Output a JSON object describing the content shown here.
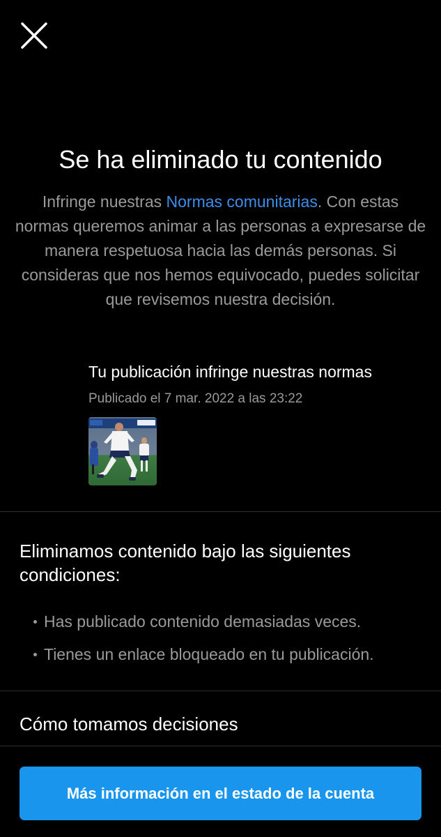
{
  "header": {
    "close_icon": "close-icon"
  },
  "notice": {
    "title": "Se ha eliminado tu contenido",
    "desc_before": "Infringe nuestras ",
    "desc_link": "Normas comunitarias",
    "desc_after": ". Con estas normas queremos animar a las personas a expresarse de manera respetuosa hacia las demás personas. Si consideras que nos hemos equivocado, puedes solicitar que revisemos nuestra decisión.",
    "link_color": "#3b8eea"
  },
  "post": {
    "title": "Tu publicación infringe nuestras normas",
    "date": "Publicado el 7 mar. 2022 a las 23:22",
    "thumbnail_icon": "post-thumbnail-image"
  },
  "conditions": {
    "title": "Eliminamos contenido bajo las siguientes condiciones:",
    "items": [
      "Has publicado contenido demasiadas veces.",
      "Tienes un enlace bloqueado en tu publicación."
    ]
  },
  "how_we_decide": {
    "label": "Cómo tomamos decisiones"
  },
  "cta": {
    "label": "Más información en el estado de la cuenta",
    "color": "#1a95ee"
  }
}
